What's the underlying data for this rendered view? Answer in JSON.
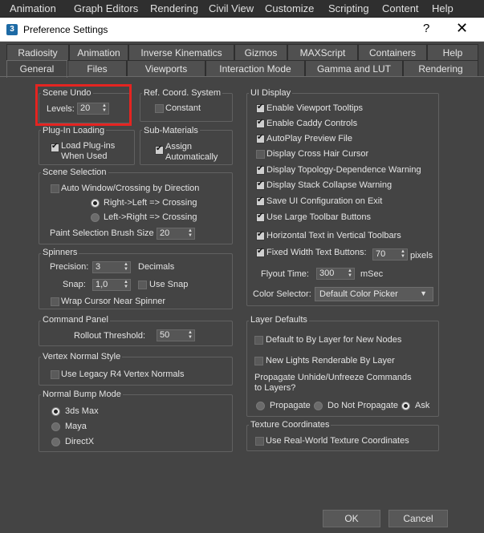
{
  "menubar": [
    "Animation",
    "Graph Editors",
    "Rendering",
    "Civil View",
    "Customize",
    "Scripting",
    "Content",
    "Help"
  ],
  "dialog": {
    "icon": "3",
    "title": "Preference Settings",
    "help": "?",
    "close": "✕"
  },
  "tabs_row1": [
    "Radiosity",
    "Animation",
    "Inverse Kinematics",
    "Gizmos",
    "MAXScript",
    "Containers",
    "Help"
  ],
  "tabs_row2": [
    "General",
    "Files",
    "Viewports",
    "Interaction Mode",
    "Gamma and LUT",
    "Rendering"
  ],
  "active_tab": "General",
  "scene_undo": {
    "title": "Scene Undo",
    "levels_label": "Levels:",
    "levels_value": "20"
  },
  "ref_coord": {
    "title": "Ref. Coord. System",
    "constant_label": "Constant",
    "constant_checked": false
  },
  "plugin_loading": {
    "title": "Plug-In Loading",
    "load_line1": "Load Plug-ins",
    "load_line2": "When Used",
    "checked": true
  },
  "sub_materials": {
    "title": "Sub-Materials",
    "assign_line1": "Assign",
    "assign_line2": "Automatically",
    "checked": true
  },
  "scene_selection": {
    "title": "Scene Selection",
    "auto_window_label": "Auto Window/Crossing by Direction",
    "auto_window_checked": false,
    "right_left_label": "Right->Left => Crossing",
    "left_right_label": "Left->Right => Crossing",
    "selected": "right-left",
    "paint_brush_label": "Paint Selection Brush Size",
    "paint_brush_value": "20"
  },
  "spinners": {
    "title": "Spinners",
    "precision_label": "Precision:",
    "precision_value": "3",
    "decimals_label": "Decimals",
    "snap_label": "Snap:",
    "snap_value": "1,0",
    "use_snap_label": "Use Snap",
    "use_snap_checked": false,
    "wrap_cursor_label": "Wrap Cursor Near Spinner",
    "wrap_cursor_checked": false
  },
  "command_panel": {
    "title": "Command Panel",
    "rollout_label": "Rollout Threshold:",
    "rollout_value": "50"
  },
  "vertex_normal": {
    "title": "Vertex Normal Style",
    "legacy_label": "Use Legacy R4 Vertex Normals",
    "legacy_checked": false
  },
  "normal_bump": {
    "title": "Normal Bump Mode",
    "options": [
      "3ds Max",
      "Maya",
      "DirectX"
    ],
    "selected": "3ds Max"
  },
  "ui_display": {
    "title": "UI Display",
    "options": [
      {
        "label": "Enable Viewport Tooltips",
        "checked": true
      },
      {
        "label": "Enable Caddy Controls",
        "checked": true
      },
      {
        "label": "AutoPlay Preview File",
        "checked": true
      },
      {
        "label": "Display Cross Hair Cursor",
        "checked": false
      },
      {
        "label": "Display Topology-Dependence Warning",
        "checked": true
      },
      {
        "label": "Display Stack Collapse Warning",
        "checked": true
      },
      {
        "label": "Save UI Configuration on Exit",
        "checked": true
      },
      {
        "label": "Use Large Toolbar Buttons",
        "checked": true
      },
      {
        "label": "Horizontal Text in Vertical Toolbars",
        "checked": true
      },
      {
        "label": "Fixed Width Text Buttons:",
        "checked": true
      }
    ],
    "fixed_width_value": "70",
    "pixels_label": "pixels",
    "flyout_label": "Flyout Time:",
    "flyout_value": "300",
    "msec_label": "mSec",
    "color_selector_label": "Color Selector:",
    "color_selector_value": "Default Color Picker"
  },
  "layer_defaults": {
    "title": "Layer Defaults",
    "default_bylayer_label": "Default to By Layer for New Nodes",
    "default_bylayer_checked": false,
    "new_lights_label": "New Lights Renderable By Layer",
    "new_lights_checked": false,
    "propagate_q1": "Propagate Unhide/Unfreeze Commands",
    "propagate_q2": "to Layers?",
    "propagate_options": [
      "Propagate",
      "Do Not Propagate",
      "Ask"
    ],
    "propagate_selected": "Ask"
  },
  "texture_coords": {
    "title": "Texture Coordinates",
    "realworld_label": "Use Real-World Texture Coordinates",
    "realworld_checked": false
  },
  "buttons": {
    "ok": "OK",
    "cancel": "Cancel"
  },
  "colors": {
    "highlight": "#e52421",
    "panel": "#444444",
    "menubar": "#2f2f2f"
  }
}
